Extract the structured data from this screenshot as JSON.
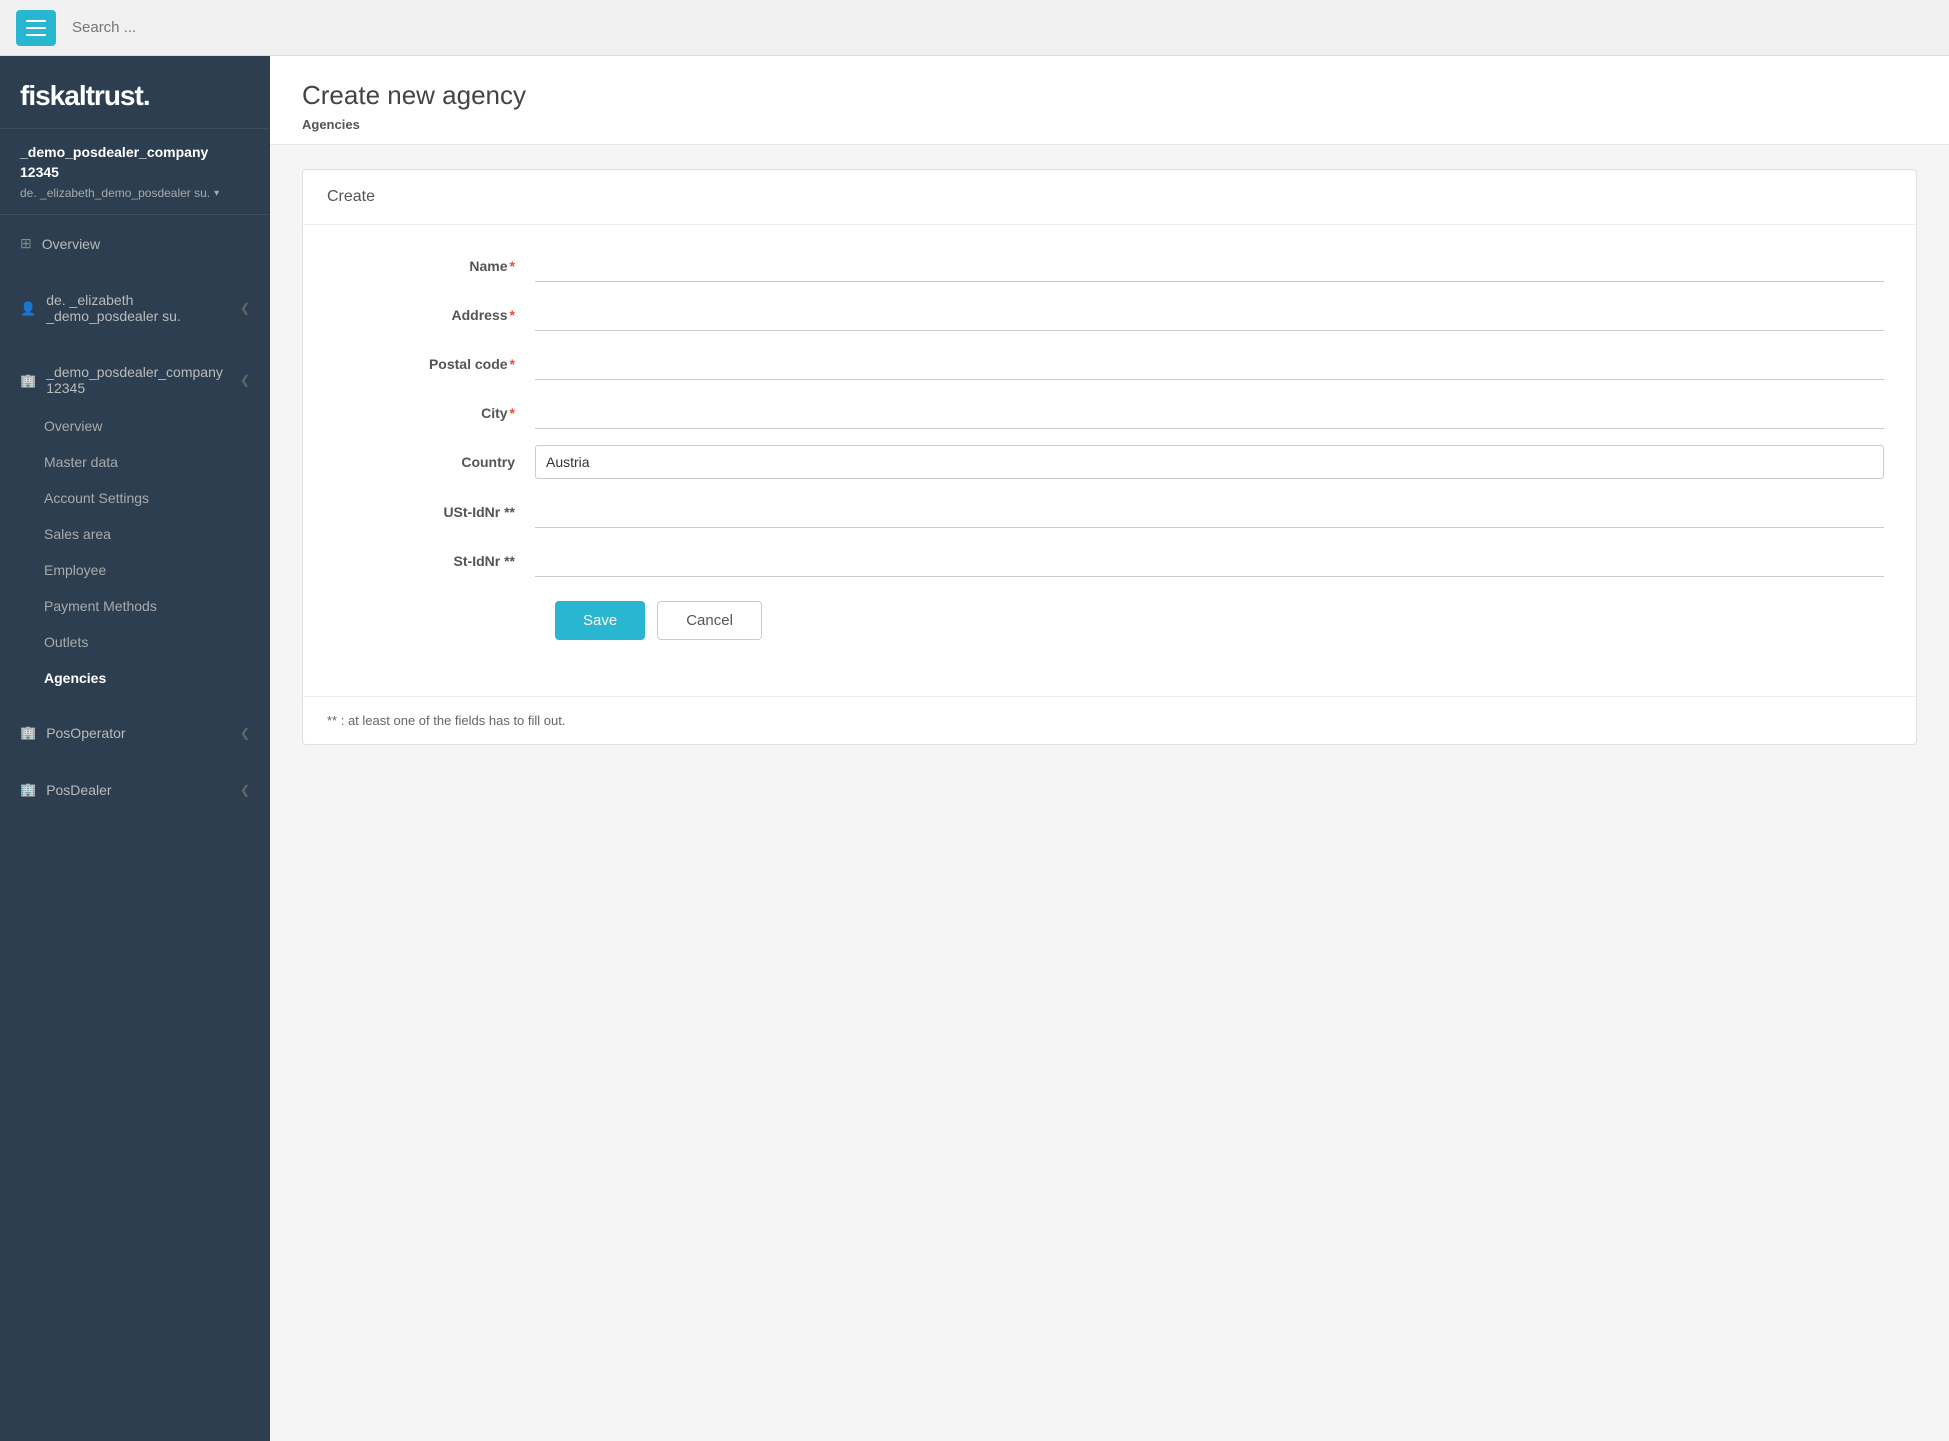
{
  "brand": {
    "name": "fiskaltrust."
  },
  "topbar": {
    "search_placeholder": "Search ..."
  },
  "sidebar": {
    "company_name": "_demo_posdealer_company 12345",
    "user_name": "de. _elizabeth_demo_posdealer su.",
    "nav_items": [
      {
        "id": "overview",
        "label": "Overview",
        "icon": "grid"
      }
    ],
    "user_group": {
      "label": "de. _elizabeth _demo_posdealer su.",
      "icon": "user"
    },
    "company_group": {
      "label": "_demo_posdealer_company 12345",
      "icon": "building",
      "sub_items": [
        {
          "id": "overview",
          "label": "Overview",
          "active": false
        },
        {
          "id": "master-data",
          "label": "Master data",
          "active": false
        },
        {
          "id": "account-settings",
          "label": "Account Settings",
          "active": false
        },
        {
          "id": "sales-area",
          "label": "Sales area",
          "active": false
        },
        {
          "id": "employee",
          "label": "Employee",
          "active": false
        },
        {
          "id": "payment-methods",
          "label": "Payment Methods",
          "active": false
        },
        {
          "id": "outlets",
          "label": "Outlets",
          "active": false
        },
        {
          "id": "agencies",
          "label": "Agencies",
          "active": true
        }
      ]
    },
    "pos_operator": {
      "label": "PosOperator",
      "icon": "building"
    },
    "pos_dealer": {
      "label": "PosDealer",
      "icon": "building"
    }
  },
  "page": {
    "title": "Create new agency",
    "breadcrumb": "Agencies"
  },
  "form": {
    "card_title": "Create",
    "fields": {
      "name": {
        "label": "Name",
        "required": true,
        "placeholder": ""
      },
      "address": {
        "label": "Address",
        "required": true,
        "placeholder": ""
      },
      "postal_code": {
        "label": "Postal code",
        "required": true,
        "placeholder": ""
      },
      "city": {
        "label": "City",
        "required": true,
        "placeholder": ""
      },
      "country": {
        "label": "Country",
        "value": "Austria"
      },
      "ust_idnr": {
        "label": "USt-IdNr **",
        "required": false,
        "placeholder": ""
      },
      "st_idnr": {
        "label": "St-IdNr **",
        "required": false,
        "placeholder": ""
      }
    },
    "save_label": "Save",
    "cancel_label": "Cancel",
    "note": "** : at least one of the fields has to fill out."
  }
}
